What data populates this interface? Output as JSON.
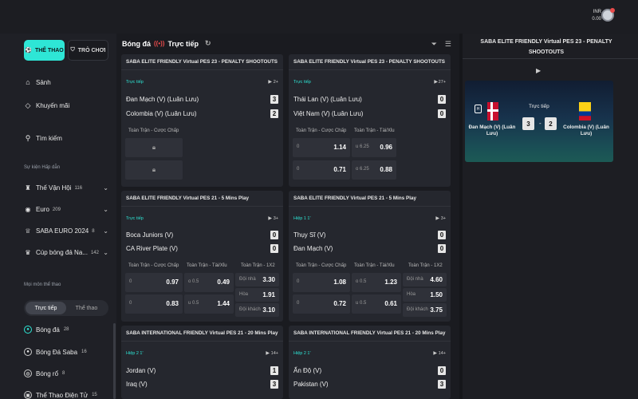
{
  "header": {
    "currency": "INR",
    "balance": "0.00"
  },
  "sidebar": {
    "tab_sport": "THỂ THAO",
    "tab_game": "TRÒ CHƠI",
    "nav": [
      {
        "label": "Sảnh"
      },
      {
        "label": "Khuyến mãi"
      },
      {
        "label": "Tìm kiếm"
      }
    ],
    "events_title": "Sự kiện Hấp dẫn",
    "events": [
      {
        "label": "Thế Vận Hội",
        "count": "116"
      },
      {
        "label": "Euro",
        "count": "209"
      },
      {
        "label": "SABA EURO 2024",
        "count": "8"
      },
      {
        "label": "Cúp bóng đá Na...",
        "count": "142"
      }
    ],
    "sports_title": "Mọi môn thể thao",
    "toggle_live": "Trực tiếp",
    "toggle_all": "Thể thao",
    "sports": [
      {
        "label": "Bóng đá",
        "count": "28"
      },
      {
        "label": "Bóng Đá Saba",
        "count": "16"
      },
      {
        "label": "Bóng rổ",
        "count": "8"
      },
      {
        "label": "Thể Thao Điện Tử",
        "count": "15"
      }
    ]
  },
  "main": {
    "sport": "Bóng đá",
    "live_label": "Trực tiếp",
    "cards": [
      {
        "title": "SABA ELITE FRIENDLY Virtual PES 23 - PENALTY SHOOTOUTS",
        "status": "Trực tiếp",
        "count": "2+",
        "home": "Đan Mạch (V) (Luân Lưu)",
        "away": "Colombia (V) (Luân Lưu)",
        "score_home": "3",
        "score_away": "2",
        "markets": [
          "Toàn Trận - Cược Chấp"
        ]
      },
      {
        "title": "SABA ELITE FRIENDLY Virtual PES 23 - PENALTY SHOOTOUTS",
        "status": "Trực tiếp",
        "count": "27+",
        "home": "Thái Lan (V) (Luân Lưu)",
        "away": "Việt Nam (V) (Luân Lưu)",
        "score_home": "0",
        "score_away": "0",
        "markets": [
          "Toàn Trận - Cược Chấp",
          "Toàn Trận - Tài/Xỉu"
        ],
        "odds": [
          [
            "0",
            "1.14",
            "u 6.25",
            "0.96"
          ],
          [
            "0",
            "0.71",
            "o 6.25",
            "0.88"
          ]
        ]
      },
      {
        "title": "SABA ELITE FRIENDLY Virtual PES 21 - 5 Mins Play",
        "status": "Trực tiếp",
        "count": "3+",
        "home": "Boca Juniors (V)",
        "away": "CA River Plate (V)",
        "score_home": "0",
        "score_away": "0",
        "markets": [
          "Toàn Trận - Cược Chấp",
          "Toàn Trận - Tài/Xỉu",
          "Toàn Trận - 1X2"
        ],
        "odds": [
          [
            "0",
            "0.97",
            "o 0.5",
            "0.49",
            "Đội nhà",
            "3.30"
          ],
          [
            "",
            "",
            "",
            "",
            "Hòa",
            "1.91"
          ],
          [
            "0",
            "0.83",
            "u 0.5",
            "1.44",
            "Đội khách",
            "3.10"
          ]
        ]
      },
      {
        "title": "SABA ELITE FRIENDLY Virtual PES 21 - 5 Mins Play",
        "status": "Hiệp 1 1'",
        "count": "3+",
        "home": "Thụy Sĩ (V)",
        "away": "Đan Mạch (V)",
        "score_home": "0",
        "score_away": "0",
        "markets": [
          "Toàn Trận - Cược Chấp",
          "Toàn Trận - Tài/Xỉu",
          "Toàn Trận - 1X2"
        ],
        "odds": [
          [
            "0",
            "1.08",
            "o 0.5",
            "1.23",
            "Đội nhà",
            "4.60"
          ],
          [
            "",
            "",
            "",
            "",
            "Hòa",
            "1.50"
          ],
          [
            "0",
            "0.72",
            "u 0.5",
            "0.61",
            "Đội khách",
            "3.75"
          ]
        ]
      },
      {
        "title": "SABA INTERNATIONAL FRIENDLY Virtual PES 21 - 20 Mins Play",
        "status": "Hiệp 2 1'",
        "count": "14+",
        "home": "Jordan (V)",
        "away": "Iraq (V)",
        "score_home": "1",
        "score_away": "3"
      },
      {
        "title": "SABA INTERNATIONAL FRIENDLY Virtual PES 21 - 20 Mins Play",
        "status": "Hiệp 2 1'",
        "count": "14+",
        "home": "Ấn Độ (V)",
        "away": "Pakistan (V)",
        "score_home": "0",
        "score_away": "3"
      }
    ]
  },
  "right": {
    "title": "SABA ELITE FRIENDLY Virtual PES 23 - PENALTY SHOOTOUTS",
    "status": "Trực tiếp",
    "home": "Đan Mạch (V) (Luân Lưu)",
    "away": "Colombia (V) (Luân Lưu)",
    "score_home": "3",
    "score_away": "2",
    "dash": "-",
    "home_badge": "H"
  },
  "colors": {
    "accent": "#2ee6d6",
    "panel": "#25272e"
  }
}
